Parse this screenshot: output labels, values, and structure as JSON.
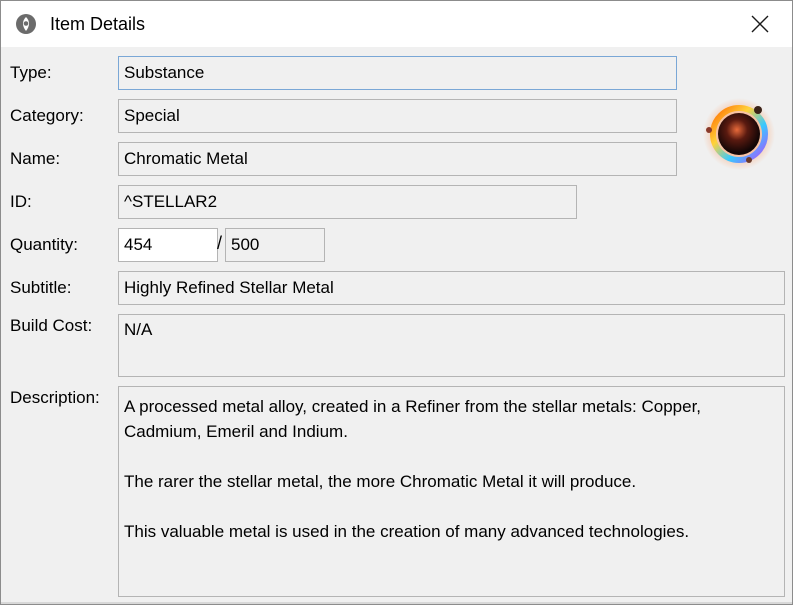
{
  "window": {
    "title": "Item Details",
    "app_icon": "app-logo-icon",
    "close_icon": "close-icon"
  },
  "labels": {
    "type": "Type:",
    "category": "Category:",
    "name": "Name:",
    "id": "ID:",
    "quantity": "Quantity:",
    "subtitle": "Subtitle:",
    "build_cost": "Build Cost:",
    "description": "Description:"
  },
  "values": {
    "type": "Substance",
    "category": "Special",
    "name": "Chromatic Metal",
    "id": "^STELLAR2",
    "quantity": "454",
    "quantity_separator": "/",
    "quantity_max": "500",
    "subtitle": "Highly Refined Stellar Metal",
    "build_cost": "N/A",
    "description": [
      "A processed metal alloy, created in a Refiner from the stellar metals: Copper, Cadmium, Emeril and Indium.",
      "The rarer the stellar metal, the more Chromatic Metal it will produce.",
      "This valuable metal is used in the creation of many advanced technologies."
    ]
  },
  "item_icon": "chromatic-metal-icon"
}
